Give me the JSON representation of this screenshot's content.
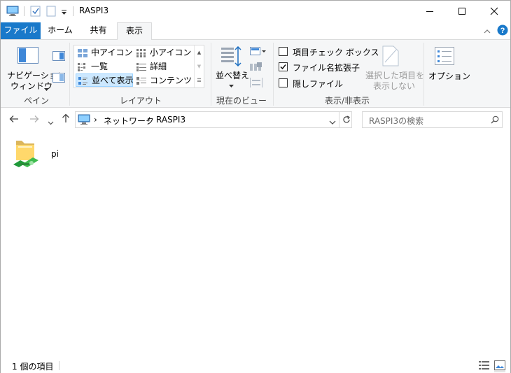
{
  "window": {
    "title": "RASPI3"
  },
  "tabs": {
    "file": "ファイル",
    "home": "ホーム",
    "share": "共有",
    "view": "表示"
  },
  "ribbon": {
    "pane": {
      "nav_pane_line1": "ナビゲーション",
      "nav_pane_line2": "ウィンドウ",
      "group_label": "ペイン"
    },
    "layout": {
      "extra_large": "中アイコン",
      "small_icons": "小アイコン",
      "list": "一覧",
      "details": "詳細",
      "tiles": "並べて表示",
      "content": "コンテンツ",
      "group_label": "レイアウト"
    },
    "current_view": {
      "sort_by": "並べ替え",
      "group_label": "現在のビュー"
    },
    "show_hide": {
      "item_checkboxes": "項目チェック ボックス",
      "item_checkboxes_checked": false,
      "file_extensions": "ファイル名拡張子",
      "file_extensions_checked": true,
      "hidden_items": "隠しファイル",
      "hidden_items_checked": false,
      "hide_selected_line1": "選択した項目を",
      "hide_selected_line2": "表示しない",
      "group_label": "表示/非表示"
    },
    "options": {
      "label": "オプション"
    }
  },
  "address": {
    "crumbs": [
      "ネットワーク",
      "RASPI3"
    ],
    "search_placeholder": "RASPI3の検索"
  },
  "content": {
    "items": [
      {
        "name": "pi",
        "icon": "shared-folder-icon"
      }
    ]
  },
  "status": {
    "item_count": "1 個の項目"
  },
  "colors": {
    "accent": "#1979ca",
    "selection": "#cce8ff",
    "ribbon_bg": "#f5f6f7"
  }
}
